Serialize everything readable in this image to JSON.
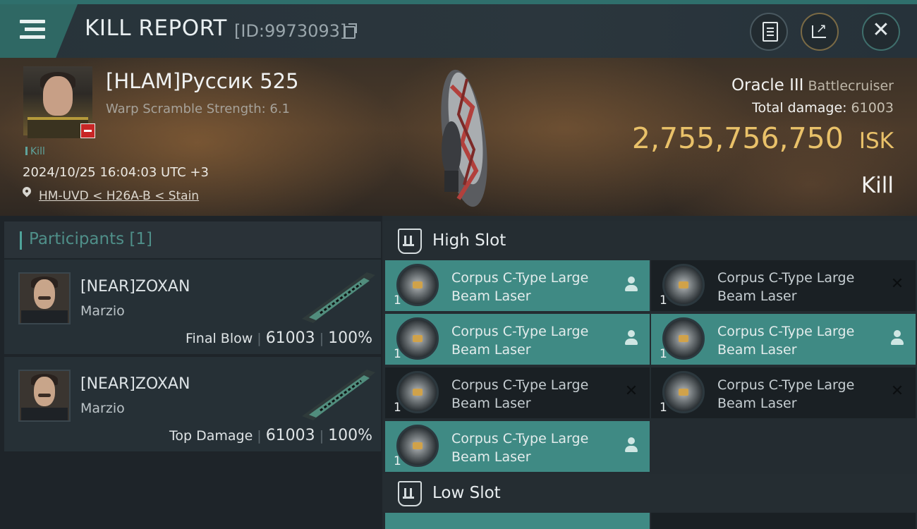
{
  "header": {
    "title": "KILL REPORT",
    "report_id": "[ID:9973093]",
    "icons": [
      "menu-icon",
      "copy-icon",
      "clipboard-icon",
      "share-icon",
      "close-icon"
    ]
  },
  "victim": {
    "name": "[HLAM]Руссик 525",
    "warp_scramble": "Warp Scramble Strength: 6.1",
    "tag": "Kill",
    "datetime": "2024/10/25 16:04:03 UTC +3",
    "location": "HM-UVD < H26A-B < Stain",
    "ship_name": "Oracle III",
    "ship_class": "Battlecruiser",
    "total_damage_label": "Total damage:",
    "total_damage": "61003",
    "isk_value": "2,755,756,750",
    "isk_unit": "ISK",
    "result": "Kill"
  },
  "participants": {
    "title": "Participants [1]",
    "list": [
      {
        "name": "[NEAR]ZOXAN",
        "corp": "Marzio",
        "role": "Final Blow",
        "damage": "61003",
        "percent": "100%"
      },
      {
        "name": "[NEAR]ZOXAN",
        "corp": "Marzio",
        "role": "Top Damage",
        "damage": "61003",
        "percent": "100%"
      }
    ]
  },
  "fitting": {
    "high_slot_title": "High Slot",
    "low_slot_title": "Low Slot",
    "high_items": [
      {
        "name": "Corpus C-Type Large Beam Laser",
        "qty": "1",
        "state": "dropped"
      },
      {
        "name": "Corpus C-Type Large Beam Laser",
        "qty": "1",
        "state": "destroyed"
      },
      {
        "name": "Corpus C-Type Large Beam Laser",
        "qty": "1",
        "state": "dropped"
      },
      {
        "name": "Corpus C-Type Large Beam Laser",
        "qty": "1",
        "state": "dropped"
      },
      {
        "name": "Corpus C-Type Large Beam Laser",
        "qty": "1",
        "state": "destroyed"
      },
      {
        "name": "Corpus C-Type Large Beam Laser",
        "qty": "1",
        "state": "destroyed"
      },
      {
        "name": "Corpus C-Type Large Beam Laser",
        "qty": "1",
        "state": "dropped"
      }
    ]
  },
  "colors": {
    "accent": "#3f8a84",
    "isk": "#e9c169",
    "standing": "#c82626"
  }
}
